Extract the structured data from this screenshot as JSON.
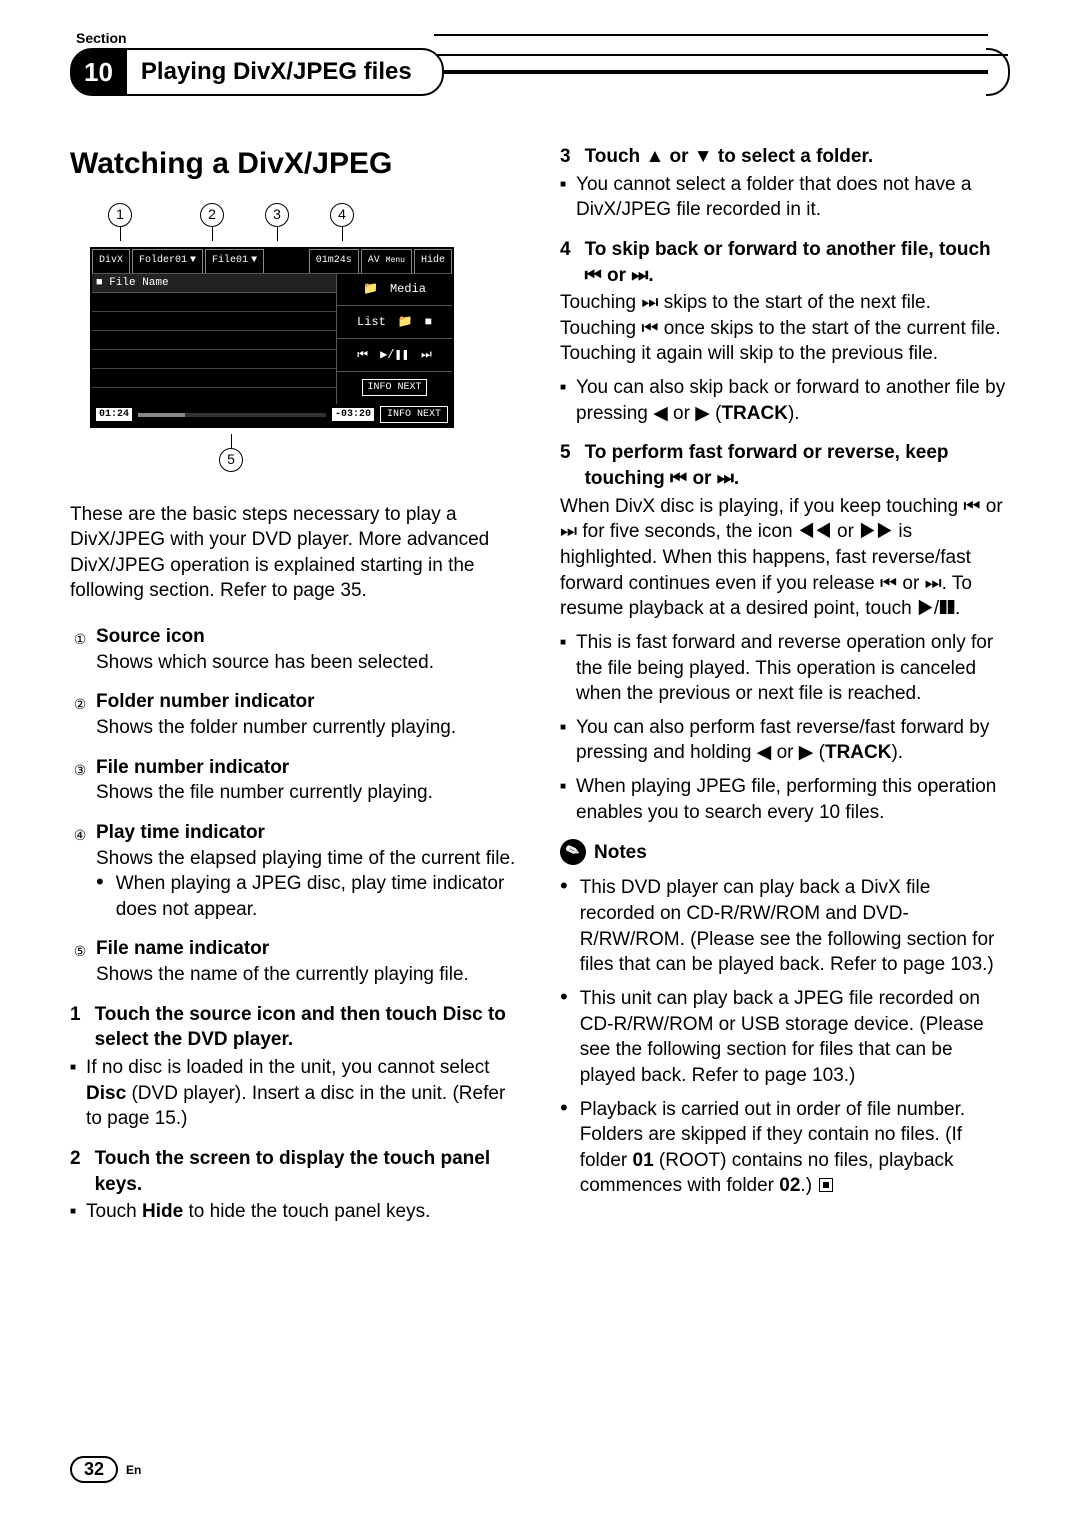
{
  "header": {
    "section_label": "Section",
    "number": "10",
    "title": "Playing DivX/JPEG files"
  },
  "main_heading": "Watching a DivX/JPEG",
  "screenshot": {
    "callouts": {
      "c1": "1",
      "c2": "2",
      "c3": "3",
      "c4": "4",
      "c5": "5"
    },
    "top_tabs": {
      "divx": "DivX",
      "folder": "Folder01",
      "file": "File01",
      "time": "01m24s",
      "av": "AV",
      "menu": "Menu",
      "hide": "Hide"
    },
    "left_header": "■ File Name",
    "right": {
      "row1_folder_icon": "📁",
      "row1_label": "Media",
      "row2_list": "List",
      "row2_icon1": "📁",
      "row2_icon2": "■",
      "row3_prev": "⏮",
      "row3_play": "▶/❚❚",
      "row3_next": "⏭",
      "info_next": "INFO NEXT"
    },
    "bottom_badge_left": "01:24",
    "bottom_badge_mid": "-03:20"
  },
  "intro_para": "These are the basic steps necessary to play a DivX/JPEG with your DVD player. More advanced DivX/JPEG operation is explained starting in the following section. Refer to page 35.",
  "defs": {
    "d1": {
      "num": "①",
      "label": "Source icon",
      "text": "Shows which source has been selected."
    },
    "d2": {
      "num": "②",
      "label": "Folder number indicator",
      "text": "Shows the folder number currently playing."
    },
    "d3": {
      "num": "③",
      "label": "File number indicator",
      "text": "Shows the file number currently playing."
    },
    "d4": {
      "num": "④",
      "label": "Play time indicator",
      "text": "Shows the elapsed playing time of the current file.",
      "sub": "When playing a JPEG disc, play time indicator does not appear."
    },
    "d5": {
      "num": "⑤",
      "label": "File name indicator",
      "text": "Shows the name of the currently playing file."
    }
  },
  "steps_left": {
    "s1": {
      "n": "1",
      "h": "Touch the source icon and then touch Disc to select the DVD player.",
      "b_pre": "If no disc is loaded in the unit, you cannot select ",
      "b_bold": "Disc",
      "b_post": " (DVD player). Insert a disc in the unit. (Refer to page 15.)"
    },
    "s2": {
      "n": "2",
      "h": "Touch the screen to display the touch panel keys.",
      "b_pre": "Touch ",
      "b_bold": "Hide",
      "b_post": " to hide the touch panel keys."
    }
  },
  "steps_right": {
    "s3": {
      "n": "3",
      "h": "Touch ▲ or ▼ to select a folder.",
      "b": "You cannot select a folder that does not have a DivX/JPEG file recorded in it."
    },
    "s4": {
      "n": "4",
      "h": "To skip back or forward to another file, touch ⏮ or ⏭.",
      "p1": "Touching ⏭ skips to the start of the next file. Touching ⏮ once skips to the start of the current file. Touching it again will skip to the previous file.",
      "b_pre": "You can also skip back or forward to another file by pressing ◀ or ▶ (",
      "b_bold": "TRACK",
      "b_post": ")."
    },
    "s5": {
      "n": "5",
      "h": "To perform fast forward or reverse, keep touching ⏮ or ⏭.",
      "p1": "When DivX disc is playing, if you keep touching ⏮ or ⏭ for five seconds, the icon ◀◀ or ▶▶ is highlighted. When this happens, fast reverse/fast forward continues even if you release ⏮ or ⏭. To resume playback at a desired point, touch ▶/❚❚.",
      "b1": "This is fast forward and reverse operation only for the file being played. This operation is canceled when the previous or next file is reached.",
      "b2_pre": "You can also perform fast reverse/fast forward by pressing and holding ◀ or ▶ (",
      "b2_bold": "TRACK",
      "b2_post": ").",
      "b3": "When playing JPEG file, performing this operation enables you to search every 10 files."
    }
  },
  "notes": {
    "header": "Notes",
    "n1": "This DVD player can play back a DivX file recorded on CD-R/RW/ROM and DVD-R/RW/ROM. (Please see the following section for files that can be played back. Refer to page 103.)",
    "n2": "This unit can play back a JPEG file recorded on CD-R/RW/ROM or USB storage device. (Please see the following section for files that can be played back. Refer to page 103.)",
    "n3_pre": "Playback is carried out in order of file number. Folders are skipped if they contain no files. (If folder ",
    "n3_b1": "01",
    "n3_mid": " (ROOT) contains no files, playback commences with folder ",
    "n3_b2": "02",
    "n3_post": ".)"
  },
  "footer": {
    "page": "32",
    "lang": "En"
  }
}
